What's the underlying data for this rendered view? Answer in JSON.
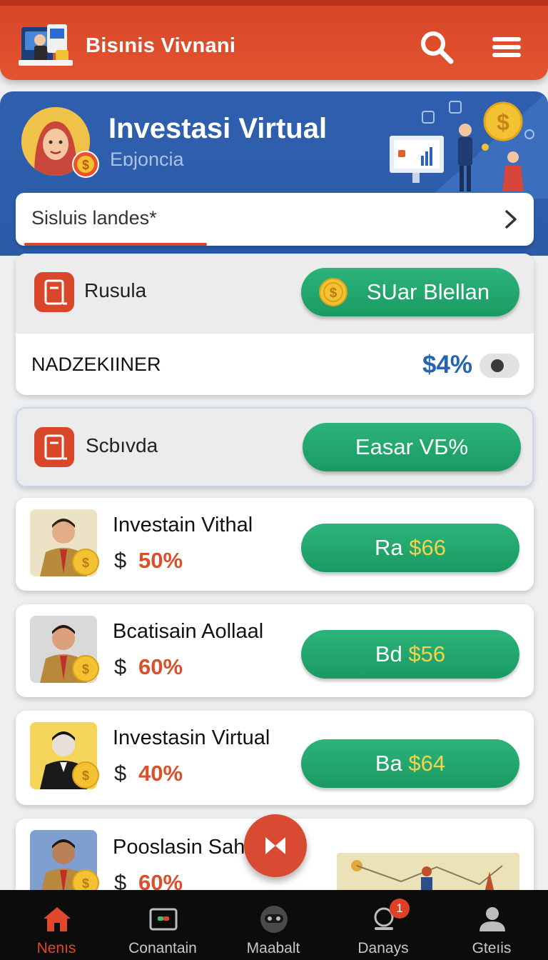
{
  "colors": {
    "brand": "#d9462a",
    "hero": "#2c5ba8",
    "button_green": "#1f9f66",
    "accent_orange": "#d9502b",
    "accent_blue": "#2563b5",
    "coin_gold": "#f2c232"
  },
  "header": {
    "title": "Bisınis Vivnani",
    "search_icon": "search-icon",
    "menu_icon": "hamburger-menu-icon"
  },
  "hero": {
    "title": "Investasi Virtual",
    "subtitle": "Eɒjoncia"
  },
  "selector": {
    "label": "Sisluis landes*"
  },
  "card1": {
    "label": "Rusula",
    "button_label": "SUar Blellan",
    "row_label": "NADZEKIINER",
    "row_value": "$4%"
  },
  "card2": {
    "label": "Scbıvda",
    "button_label": "Easar VБ%"
  },
  "investments": [
    {
      "name": "Investain Vithal",
      "currency": "$",
      "percent": "50%",
      "btn_prefix": "Ra",
      "btn_amount": "$66"
    },
    {
      "name": "Bcatisain Aollaal",
      "currency": "$",
      "percent": "60%",
      "btn_prefix": "Bd",
      "btn_amount": "$56"
    },
    {
      "name": "Investasin Virtual",
      "currency": "$",
      "percent": "40%",
      "btn_prefix": "Ba",
      "btn_amount": "$64"
    },
    {
      "name": "Pooslasin Sahl",
      "currency": "$",
      "percent": "60%"
    }
  ],
  "nav": [
    {
      "label": "Nenıs",
      "icon": "home-icon",
      "active": true
    },
    {
      "label": "Conantain",
      "icon": "wallet-icon"
    },
    {
      "label": "Maabalt",
      "icon": "robot-icon"
    },
    {
      "label": "Danays",
      "icon": "notification-icon",
      "badge": "1"
    },
    {
      "label": "Gteıis",
      "icon": "profile-icon"
    }
  ]
}
